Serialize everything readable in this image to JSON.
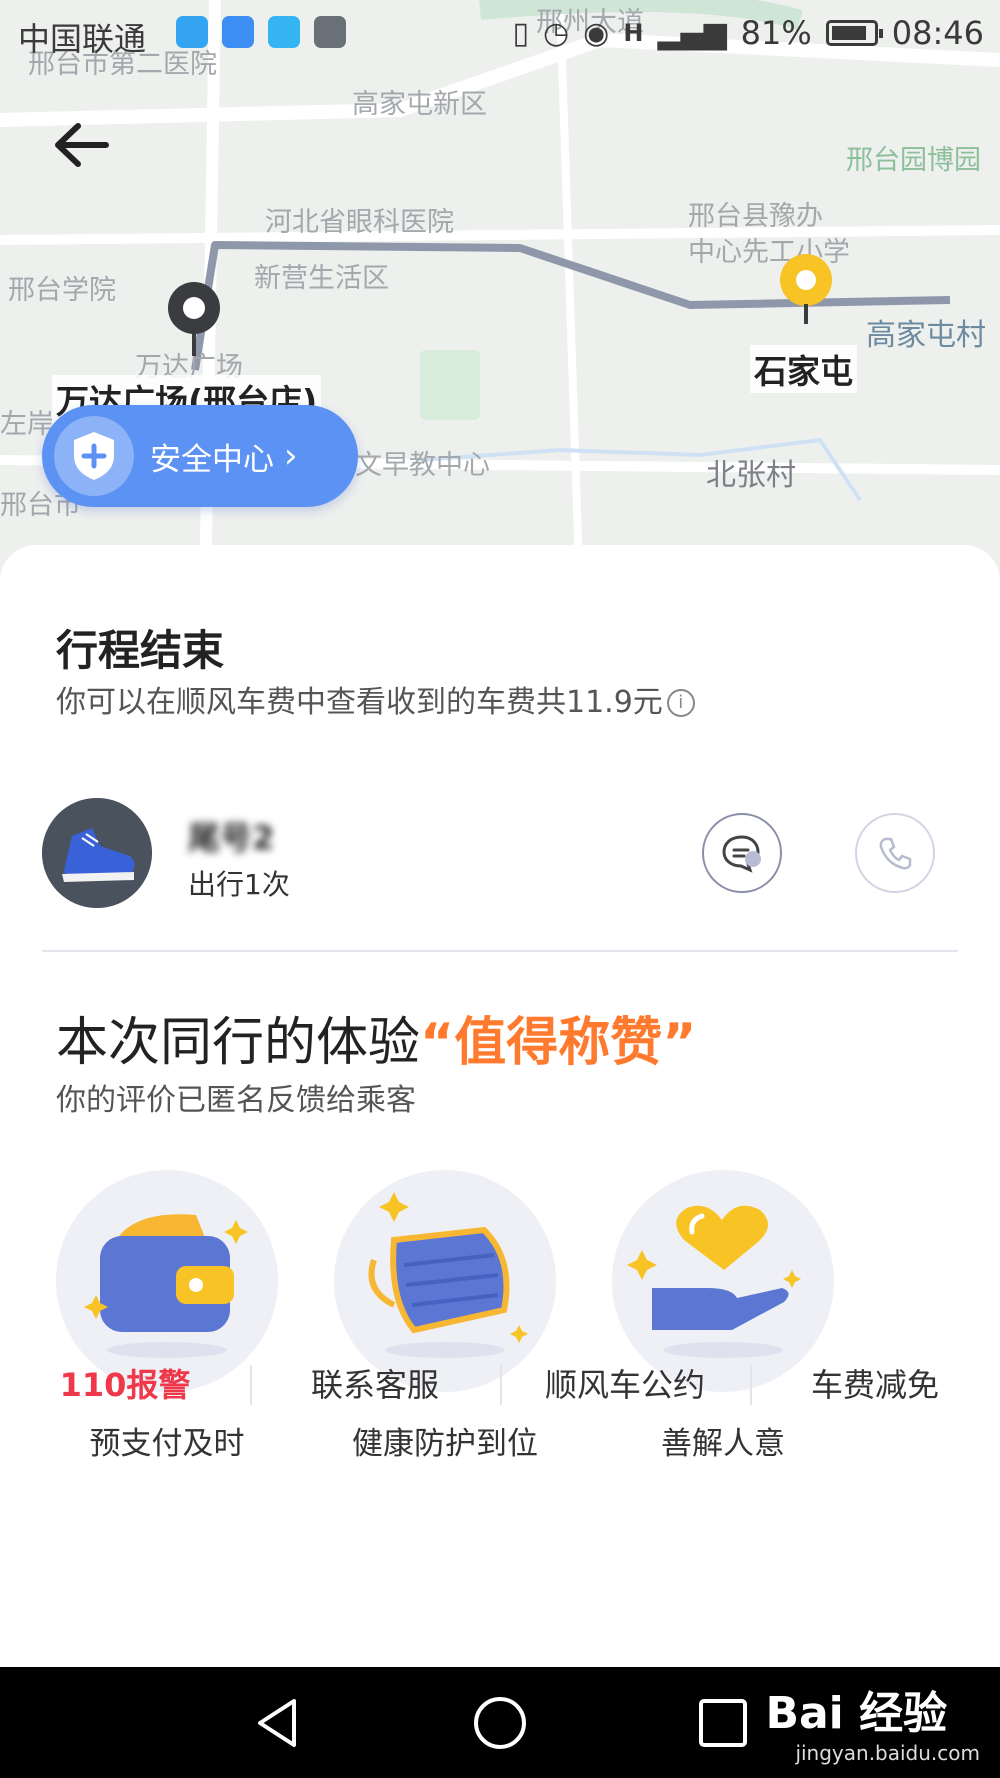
{
  "status_bar": {
    "carrier": "中国联通",
    "battery": "81%",
    "time": "08:46",
    "icons": [
      "location-icon",
      "health-icon",
      "message-icon",
      "gallery-icon",
      "vibrate-icon",
      "alarm-icon",
      "eye-icon",
      "h-signal-icon",
      "signal-icon",
      "battery-icon"
    ]
  },
  "map": {
    "labels": {
      "l1": "邢台市第二医院",
      "l2": "高家屯新区",
      "l3": "邢台园博园",
      "l4": "河北省眼科医院",
      "l5": "邢台县豫办",
      "l6": "中心先工小学",
      "l7": "邢台学院",
      "l8": "新营生活区",
      "l9": "高家屯村",
      "l10": "万达广场",
      "l11": "左岸",
      "l12": "文早教中心",
      "l13": "北张村",
      "l14": "邢台市",
      "l15": "邢州大道"
    },
    "start_label": "万达广场(邢台店)",
    "end_label": "石家屯"
  },
  "safety_center": {
    "label": "安全中心"
  },
  "trip": {
    "title": "行程结束",
    "subtitle": "你可以在顺风车费中查看收到的车费共11.9元"
  },
  "passenger": {
    "name": "尾号2",
    "trips": "出行1次"
  },
  "rating": {
    "title_prefix": "本次同行的体验",
    "title_highlight": "“值得称赞”",
    "subtitle": "你的评价已匿名反馈给乘客",
    "tags": [
      {
        "label": "预支付及时",
        "icon": "wallet-icon"
      },
      {
        "label": "健康防护到位",
        "icon": "mask-icon"
      },
      {
        "label": "善解人意",
        "icon": "heart-hand-icon"
      }
    ]
  },
  "bottom_links": {
    "alarm": "110报警",
    "service": "联系客服",
    "convention": "顺风车公约",
    "fee_waiver": "车费减免"
  },
  "watermark": {
    "brand": "Bai 经验",
    "url": "jingyan.baidu.com"
  },
  "colors": {
    "accent_blue": "#5b92f4",
    "highlight_orange": "#ff7a2e",
    "alarm_red": "#f0384b",
    "pin_yellow": "#f7c325"
  }
}
